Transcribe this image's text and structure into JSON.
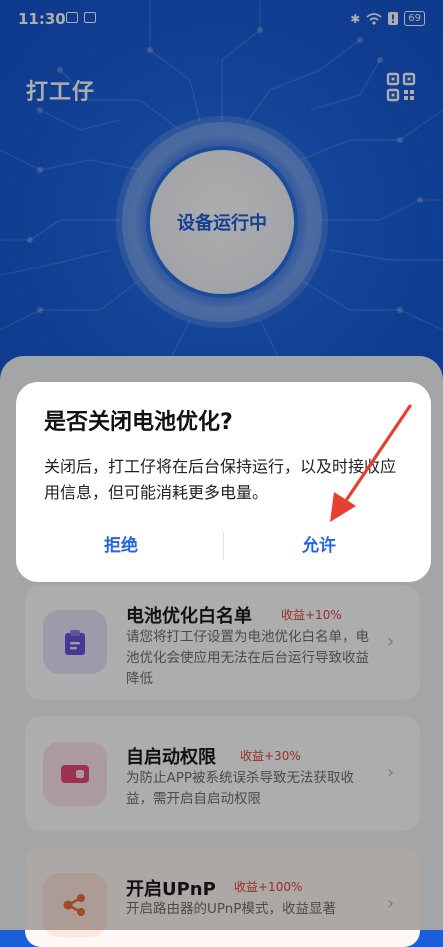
{
  "status_bar": {
    "time": "11:30",
    "battery": "69"
  },
  "header": {
    "title": "打工仔",
    "qr_icon": "qr-code-icon"
  },
  "device": {
    "status": "设备运行中"
  },
  "cards": [
    {
      "icon": "clipboard-icon",
      "icon_bg": "#e7e3fb",
      "icon_color": "#6a52d9",
      "title": "电池优化白名单",
      "badge": "收益+10%",
      "desc": "请您将打工仔设置为电池优化白名单，电池优化会使应用无法在后台运行导致收益降低"
    },
    {
      "icon": "toggle-icon",
      "icon_bg": "#fde3ea",
      "icon_color": "#e8497a",
      "title": "自启动权限",
      "badge": "收益+30%",
      "desc": "为防止APP被系统误杀导致无法获取收益，需开启自启动权限"
    },
    {
      "icon": "share-nodes-icon",
      "icon_bg": "#fde6dc",
      "icon_color": "#ef6a3a",
      "title": "开启UPnP",
      "badge": "收益+100%",
      "desc": "开启路由器的UPnP模式，收益显著"
    }
  ],
  "dialog": {
    "title": "是否关闭电池优化?",
    "message": "关闭后，打工仔将在后台保持运行，以及时接收应用信息，但可能消耗更多电量。",
    "reject_label": "拒绝",
    "allow_label": "允许"
  },
  "colors": {
    "brand_blue": "#1f66e0",
    "button_blue": "#2565e3",
    "badge_red": "#e2463b",
    "arrow_red": "#e8402e"
  }
}
